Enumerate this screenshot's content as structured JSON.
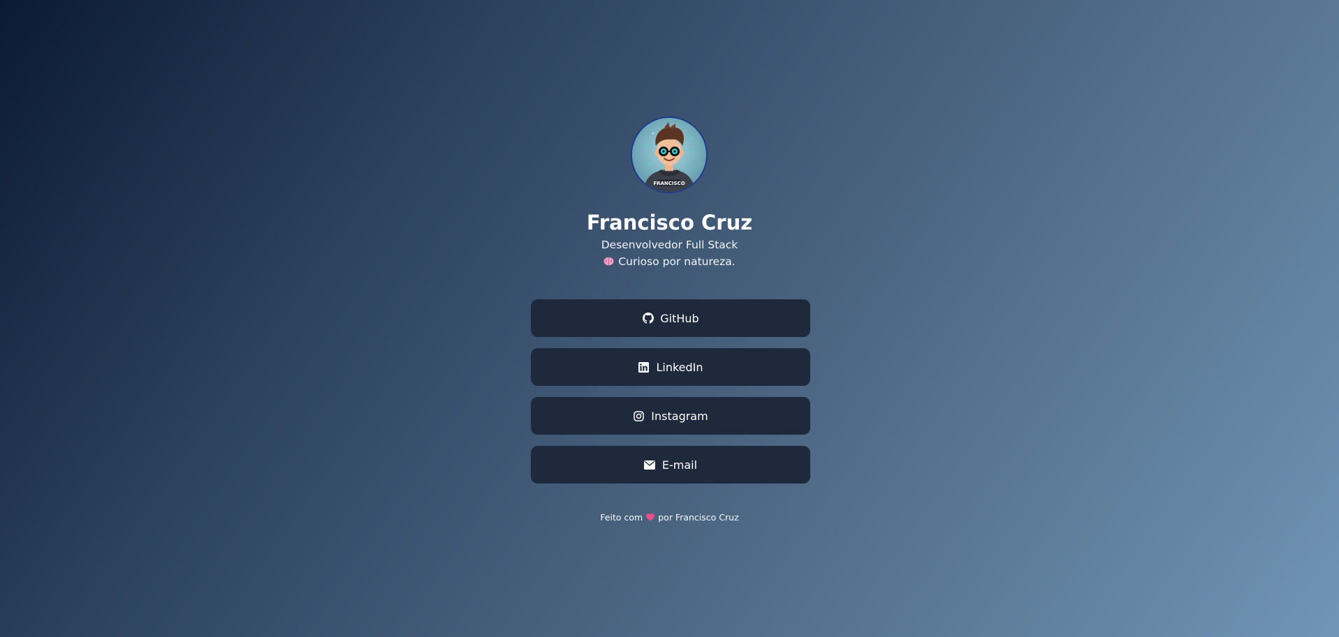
{
  "profile": {
    "avatar_caption": "FRANCISCO",
    "name": "Francisco Cruz",
    "role": "Desenvolvedor Full Stack",
    "tagline": "Curioso por natureza.",
    "tagline_icon": "brain-icon"
  },
  "links": [
    {
      "label": "GitHub",
      "icon": "github-icon"
    },
    {
      "label": "LinkedIn",
      "icon": "linkedin-icon"
    },
    {
      "label": "Instagram",
      "icon": "instagram-icon"
    },
    {
      "label": "E-mail",
      "icon": "mail-icon"
    }
  ],
  "footer": {
    "prefix": "Feito com",
    "suffix": "por Francisco Cruz",
    "heart_icon": "heart-icon"
  },
  "colors": {
    "button_bg": "#1e293b",
    "avatar_border": "#1e3a8a",
    "text": "#ffffff"
  }
}
